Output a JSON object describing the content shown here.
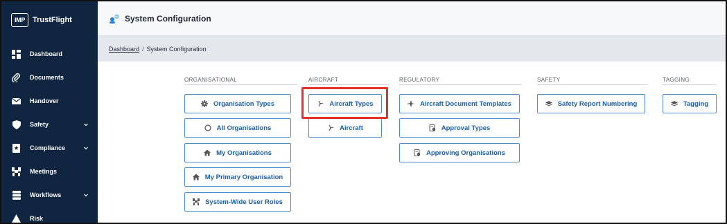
{
  "brand": {
    "logo_text": "IMP",
    "name": "TrustFlight"
  },
  "sidebar": {
    "items": [
      {
        "label": "Dashboard",
        "icon": "dashboard-icon",
        "has_chevron": false
      },
      {
        "label": "Documents",
        "icon": "paperclip-icon",
        "has_chevron": false
      },
      {
        "label": "Handover",
        "icon": "envelope-icon",
        "has_chevron": false
      },
      {
        "label": "Safety",
        "icon": "shield-icon",
        "has_chevron": true
      },
      {
        "label": "Compliance",
        "icon": "star-document-icon",
        "has_chevron": true
      },
      {
        "label": "Meetings",
        "icon": "meetings-icon",
        "has_chevron": false
      },
      {
        "label": "Workflows",
        "icon": "workflows-icon",
        "has_chevron": true
      },
      {
        "label": "Risk",
        "icon": "warning-icon",
        "has_chevron": false
      }
    ]
  },
  "header": {
    "title": "System Configuration",
    "icon": "settings-people-icon"
  },
  "breadcrumb": {
    "link": "Dashboard",
    "separator": "/",
    "current": "System Configuration"
  },
  "sections": {
    "organisational": {
      "title": "ORGANISATIONAL",
      "buttons": [
        {
          "label": "Organisation Types",
          "icon": "gear-icon"
        },
        {
          "label": "All Organisations",
          "icon": "circle-icon"
        },
        {
          "label": "My Organisations",
          "icon": "home-icon"
        },
        {
          "label": "My Primary Organisation",
          "icon": "home-icon"
        },
        {
          "label": "System-Wide User Roles",
          "icon": "users-icon"
        }
      ]
    },
    "aircraft": {
      "title": "AIRCRAFT",
      "buttons": [
        {
          "label": "Aircraft Types",
          "icon": "propeller-icon"
        },
        {
          "label": "Aircraft",
          "icon": "propeller-icon"
        }
      ]
    },
    "regulatory": {
      "title": "REGULATORY",
      "buttons": [
        {
          "label": "Aircraft Document Templates",
          "icon": "plane-icon"
        },
        {
          "label": "Approval Types",
          "icon": "stamp-icon"
        },
        {
          "label": "Approving Organisations",
          "icon": "stamp-icon"
        }
      ]
    },
    "safety": {
      "title": "SAFETY",
      "buttons": [
        {
          "label": "Safety Report Numbering",
          "icon": "layers-icon"
        }
      ]
    },
    "tagging": {
      "title": "TAGGING",
      "buttons": [
        {
          "label": "Tagging",
          "icon": "layers-icon"
        }
      ]
    }
  },
  "colors": {
    "sidebar_bg": "#0f2540",
    "button_border": "#4f8dc9",
    "button_text": "#1a5fa6",
    "highlight": "#e3322c"
  }
}
